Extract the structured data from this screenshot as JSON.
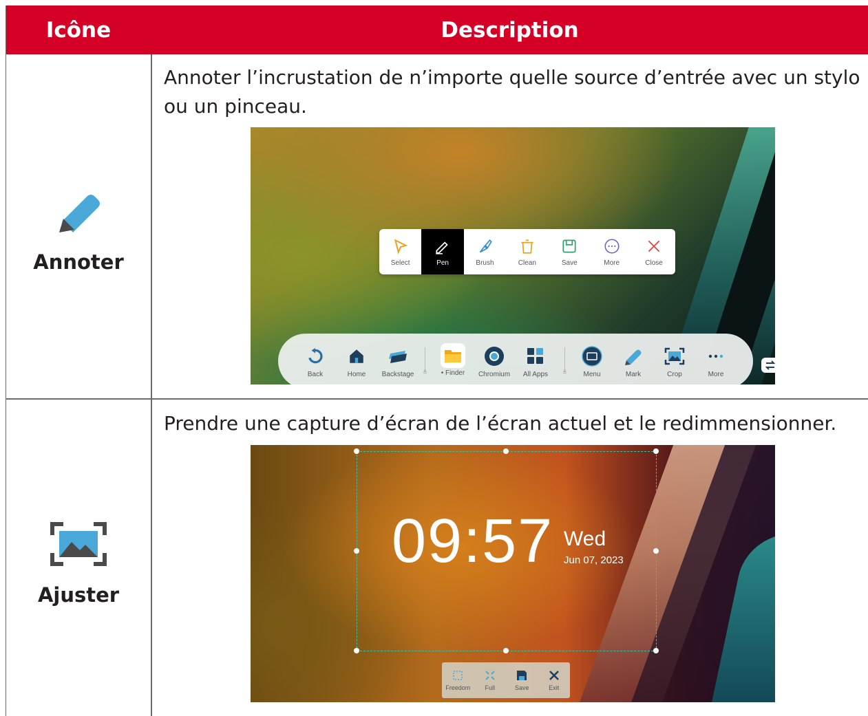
{
  "table": {
    "headers": {
      "icon": "Icône",
      "description": "Description"
    },
    "rows": [
      {
        "icon": "pen-icon",
        "label": "Annoter",
        "description_line1": "Annoter l’incrustation de n’importe quelle source d’entrée avec un stylo",
        "description_line2": "ou un pinceau.",
        "screenshot": {
          "toolbar": [
            "Select",
            "Pen",
            "Brush",
            "Clean",
            "Save",
            "More",
            "Close"
          ],
          "active_tool": "Pen",
          "dock": [
            "Back",
            "Home",
            "Backstage",
            "• Finder",
            "Chromium",
            "All Apps",
            "Menu",
            "Mark",
            "Crop",
            "More"
          ]
        }
      },
      {
        "icon": "crop-image-icon",
        "label": "Ajuster",
        "description_line1": "Prendre une capture d’écran de l’écran actuel et le redimmensionner.",
        "screenshot": {
          "time": "09:57",
          "day": "Wed",
          "date": "Jun 07, 2023",
          "toolbar": [
            "Freedom",
            "Full",
            "Save",
            "Exit"
          ]
        }
      }
    ]
  },
  "colors": {
    "header": "#d50025",
    "accent_teal": "#2fc5a8",
    "icon_blue": "#4aa8d8"
  }
}
